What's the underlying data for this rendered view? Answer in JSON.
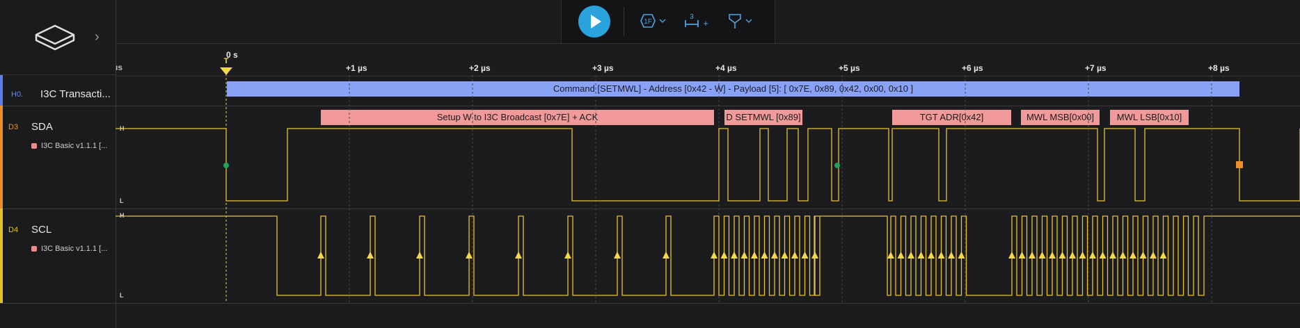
{
  "toolbar": {
    "play_icon": "play-icon",
    "trigger_label": "1F",
    "measure_count": "3",
    "measure_plus": "+",
    "marker_icon": "marker-icon"
  },
  "ruler": {
    "zero_label": "0 s",
    "left_edge_label": "ıs",
    "ticks": [
      "+1 µs",
      "+2 µs",
      "+3 µs",
      "+4 µs",
      "+5 µs",
      "+6 µs",
      "+7 µs",
      "+8 µs"
    ],
    "trigger_label": "T"
  },
  "channels": {
    "h0": {
      "id": "H0.",
      "name": "I3C Transacti...",
      "color": "#5b7fe8",
      "frame": "Command [SETMWL] - Address [0x42 - W] - Payload [5]: [ 0x7E, 0x89, 0x42, 0x00, 0x10 ]"
    },
    "d3": {
      "id": "D3",
      "name": "SDA",
      "analyzer": "I3C Basic v1.1.1 [...",
      "high": "H",
      "low": "L",
      "color": "#e8902c",
      "frames": [
        "Setup W to I3C Broadcast [0x7E] + ACK",
        "D SETMWL [0x89]",
        "TGT ADR[0x42]",
        "MWL MSB[0x00]",
        "MWL LSB[0x10]"
      ]
    },
    "d4": {
      "id": "D4",
      "name": "SCL",
      "analyzer": "I3C Basic v1.1.1 [...",
      "high": "H",
      "low": "L",
      "color": "#e2c22a"
    }
  }
}
